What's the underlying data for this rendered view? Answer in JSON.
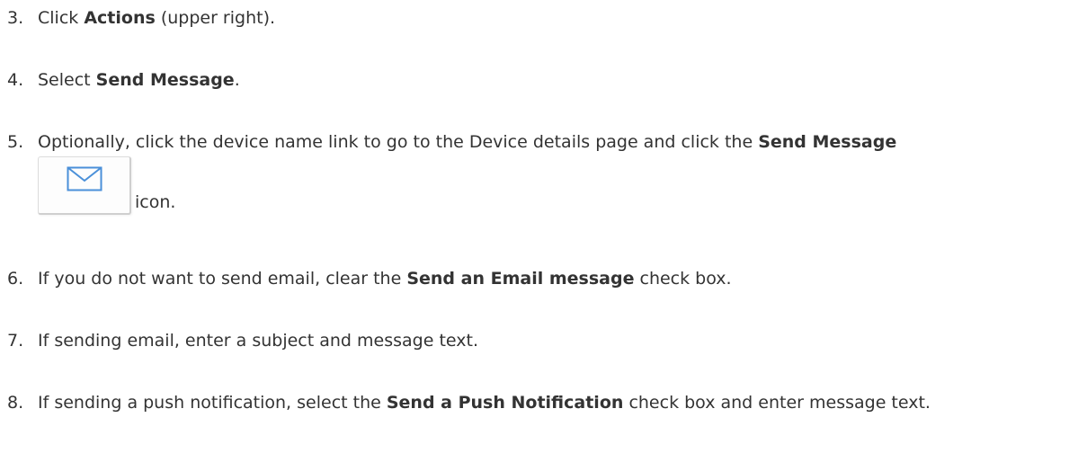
{
  "steps": [
    {
      "number": "3.",
      "parts": [
        "Click ",
        "Actions",
        " (upper right)."
      ]
    },
    {
      "number": "4.",
      "parts": [
        "Select ",
        "Send Message",
        "."
      ]
    },
    {
      "number": "5.",
      "parts": [
        "Optionally, click the device name link to go to the Device details page and click the ",
        "Send Message"
      ],
      "icon_name": "envelope-icon",
      "icon_suffix": "icon."
    },
    {
      "number": "6.",
      "parts": [
        "If you do not want to send email, clear the ",
        "Send an Email message",
        " check box."
      ]
    },
    {
      "number": "7.",
      "parts": [
        "If sending email, enter a subject and message text."
      ]
    },
    {
      "number": "8.",
      "parts": [
        "If sending a push notification, select the ",
        "Send a Push Notification",
        " check box and enter message text."
      ]
    }
  ],
  "colors": {
    "text": "#333333",
    "icon_stroke": "#4a90d9"
  }
}
